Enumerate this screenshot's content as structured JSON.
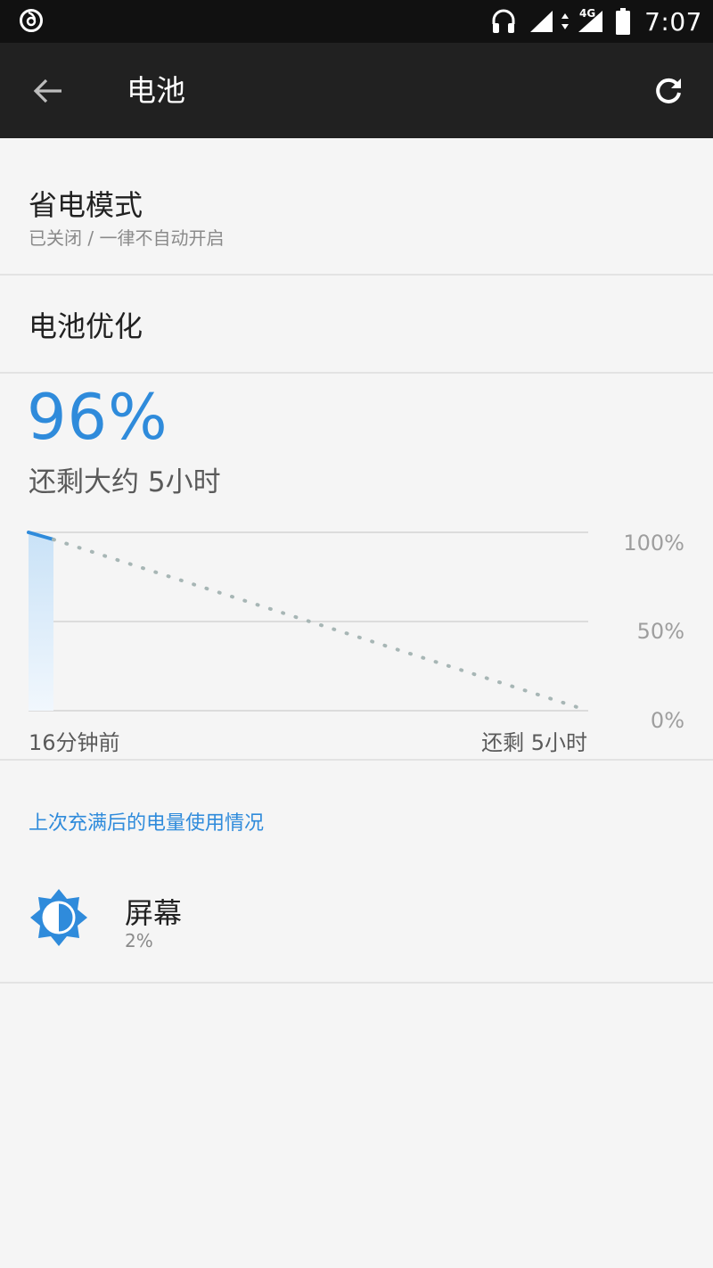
{
  "status_bar": {
    "time": "7:07",
    "network_label": "4G",
    "icons": [
      "netease-music-icon",
      "headphone-icon",
      "signal-icon",
      "data-arrows-icon",
      "signal-4g-icon",
      "battery-icon"
    ]
  },
  "app_bar": {
    "title": "电池",
    "back_icon": "arrow-back-icon",
    "refresh_icon": "refresh-icon"
  },
  "power_saving": {
    "title": "省电模式",
    "summary": "已关闭 / 一律不自动开启"
  },
  "battery_optimization": {
    "title": "电池优化"
  },
  "battery": {
    "level": "96%",
    "remaining": "还剩大约 5小时",
    "accent": "#2f8bdb"
  },
  "chart_data": {
    "type": "line",
    "y_ticks": [
      "100%",
      "50%",
      "0%"
    ],
    "x_labels": [
      "16分钟前",
      "还剩 5小时"
    ],
    "history": [
      {
        "t": -16,
        "level": 100
      },
      {
        "t": 0,
        "level": 96
      }
    ],
    "projection": [
      {
        "t": 0,
        "level": 96
      },
      {
        "t": 300,
        "level": 0
      }
    ],
    "ylim": [
      0,
      100
    ],
    "x_unit": "minutes",
    "grid": true
  },
  "usage": {
    "header": "上次充满后的电量使用情况",
    "items": [
      {
        "name": "屏幕",
        "percent": "2%",
        "icon": "brightness-icon"
      }
    ]
  }
}
